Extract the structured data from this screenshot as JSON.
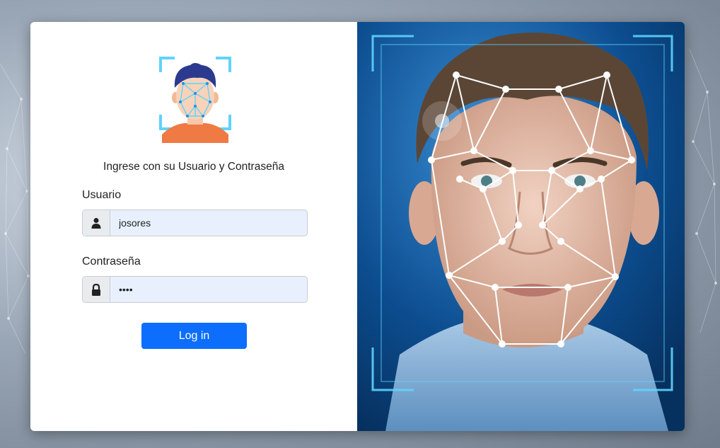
{
  "login": {
    "subtitle": "Ingrese con su Usuario y Contraseña",
    "username_label": "Usuario",
    "username_value": "josores",
    "password_label": "Contraseña",
    "password_value": "••••",
    "submit_label": "Log in"
  },
  "icons": {
    "logo": "face-scan-icon",
    "username": "user-icon",
    "password": "lock-icon"
  },
  "colors": {
    "primary_button": "#0d6efd",
    "input_fill": "#e8f0fe",
    "scan_frame": "#5fd3ff"
  }
}
